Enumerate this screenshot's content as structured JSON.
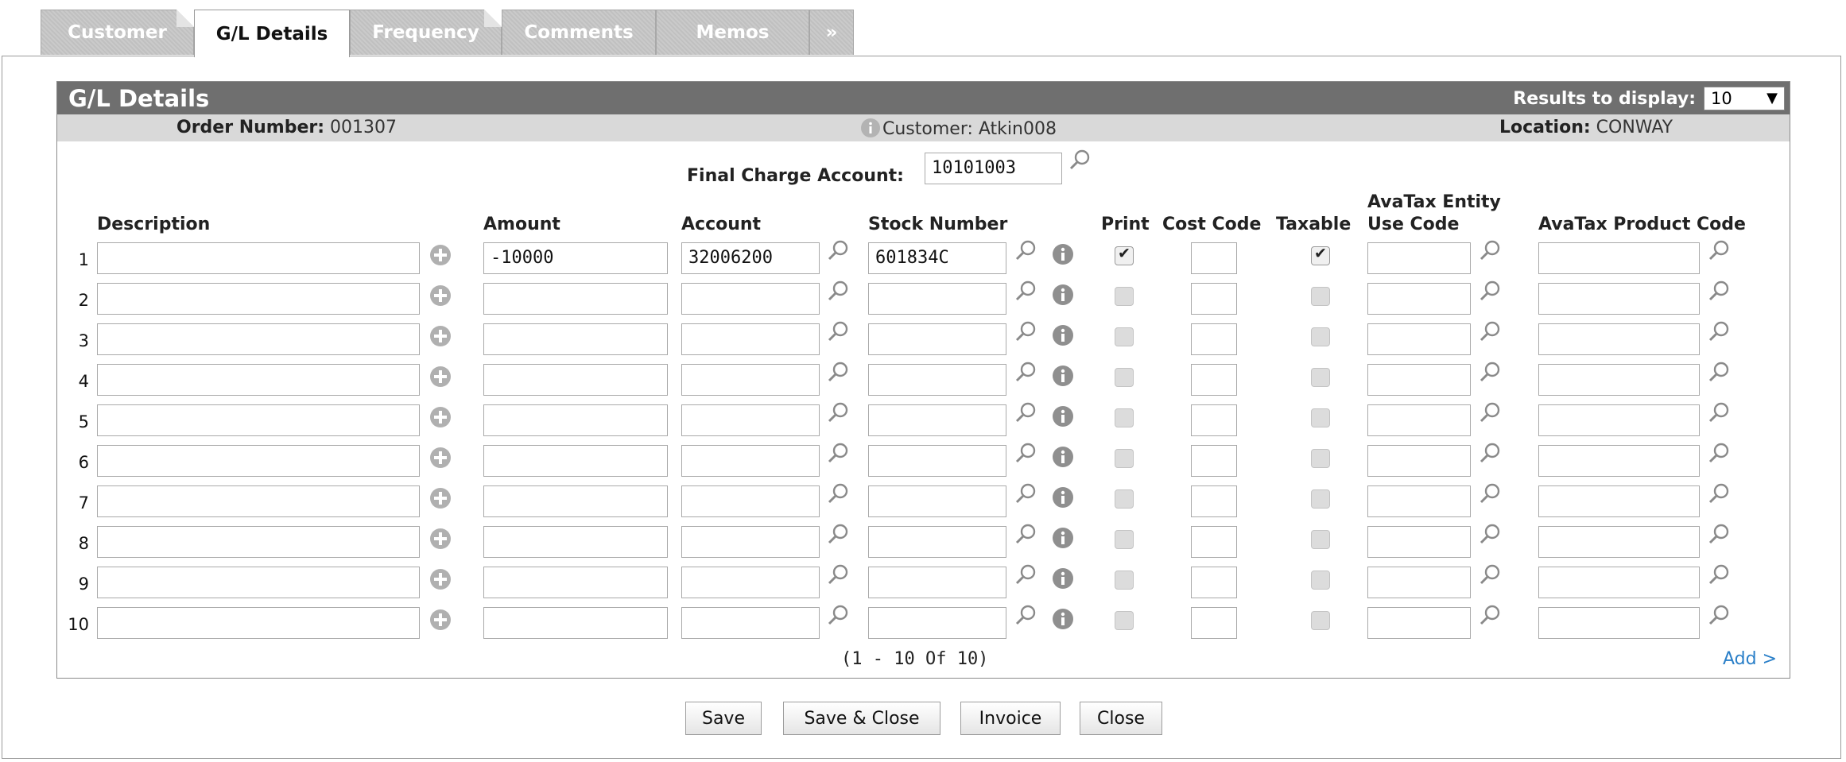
{
  "tabs": [
    {
      "label": "Customer",
      "active": false
    },
    {
      "label": "G/L Details",
      "active": true
    },
    {
      "label": "Frequency",
      "active": false
    },
    {
      "label": "Comments",
      "active": false
    },
    {
      "label": "Memos",
      "active": false
    },
    {
      "label": "»",
      "active": false
    }
  ],
  "panel": {
    "title": "G/L Details",
    "results_label": "Results to display:",
    "results_value": "10",
    "results_arrow": "▼"
  },
  "info": {
    "order_label": "Order Number:",
    "order_value": "001307",
    "customer_text": "Customer: Atkin008",
    "location_label": "Location:",
    "location_value": "CONWAY"
  },
  "final_charge": {
    "label": "Final Charge Account:",
    "value": "10101003"
  },
  "columns": {
    "description": "Description",
    "amount": "Amount",
    "account": "Account",
    "stock_number": "Stock Number",
    "print": "Print",
    "cost_code": "Cost Code",
    "taxable": "Taxable",
    "avatax_entity_line1": "AvaTax Entity",
    "avatax_entity_line2": "Use Code",
    "avatax_product": "AvaTax Product Code"
  },
  "rows": [
    {
      "num": "1",
      "description": "",
      "amount": "-10000",
      "account": "32006200",
      "stock": "601834C",
      "print": true,
      "cost_code": "",
      "taxable": true,
      "entity": "",
      "product": ""
    },
    {
      "num": "2",
      "description": "",
      "amount": "",
      "account": "",
      "stock": "",
      "print": false,
      "cost_code": "",
      "taxable": false,
      "entity": "",
      "product": ""
    },
    {
      "num": "3",
      "description": "",
      "amount": "",
      "account": "",
      "stock": "",
      "print": false,
      "cost_code": "",
      "taxable": false,
      "entity": "",
      "product": ""
    },
    {
      "num": "4",
      "description": "",
      "amount": "",
      "account": "",
      "stock": "",
      "print": false,
      "cost_code": "",
      "taxable": false,
      "entity": "",
      "product": ""
    },
    {
      "num": "5",
      "description": "",
      "amount": "",
      "account": "",
      "stock": "",
      "print": false,
      "cost_code": "",
      "taxable": false,
      "entity": "",
      "product": ""
    },
    {
      "num": "6",
      "description": "",
      "amount": "",
      "account": "",
      "stock": "",
      "print": false,
      "cost_code": "",
      "taxable": false,
      "entity": "",
      "product": ""
    },
    {
      "num": "7",
      "description": "",
      "amount": "",
      "account": "",
      "stock": "",
      "print": false,
      "cost_code": "",
      "taxable": false,
      "entity": "",
      "product": ""
    },
    {
      "num": "8",
      "description": "",
      "amount": "",
      "account": "",
      "stock": "",
      "print": false,
      "cost_code": "",
      "taxable": false,
      "entity": "",
      "product": ""
    },
    {
      "num": "9",
      "description": "",
      "amount": "",
      "account": "",
      "stock": "",
      "print": false,
      "cost_code": "",
      "taxable": false,
      "entity": "",
      "product": ""
    },
    {
      "num": "10",
      "description": "",
      "amount": "",
      "account": "",
      "stock": "",
      "print": false,
      "cost_code": "",
      "taxable": false,
      "entity": "",
      "product": ""
    }
  ],
  "pager": "(1 - 10 Of 10)",
  "add_link": "Add >",
  "buttons": {
    "save": "Save",
    "save_close": "Save & Close",
    "invoice": "Invoice",
    "close": "Close"
  },
  "colors": {
    "title_bar": "#6f6f6f",
    "info_bar": "#d9d9d9",
    "link": "#2a7fc8",
    "tab_inactive": "#c6c6c6"
  },
  "icons": {
    "add": "plus-circle-icon",
    "lookup": "magnifier-icon",
    "info": "info-circle-icon"
  }
}
